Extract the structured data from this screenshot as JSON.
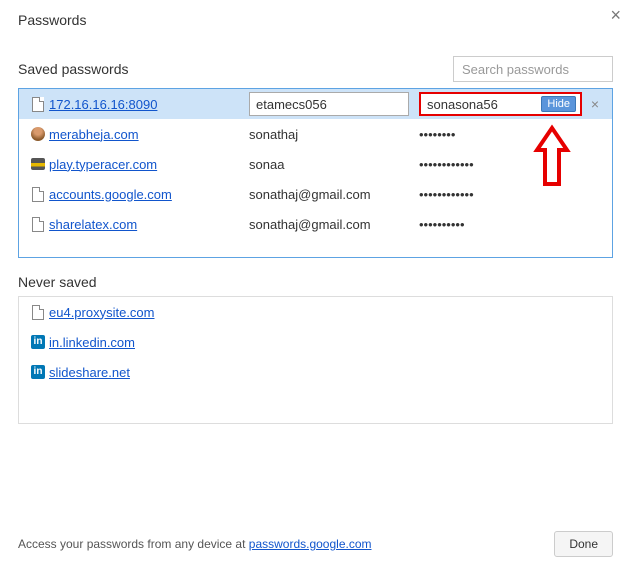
{
  "dialog": {
    "title": "Passwords",
    "close_glyph": "×"
  },
  "search": {
    "placeholder": "Search passwords"
  },
  "saved": {
    "title": "Saved passwords",
    "rows": [
      {
        "icon": "doc",
        "site": "172.16.16.16:8090",
        "username": "etamecs056",
        "password_plain": "sonasona56",
        "hide_label": "Hide",
        "delete_glyph": "×",
        "selected": true
      },
      {
        "icon": "avatar",
        "site": "merabheja.com",
        "username": "sonathaj",
        "password_mask": "••••••••"
      },
      {
        "icon": "typeracer",
        "site": "play.typeracer.com",
        "username": "sonaa",
        "password_mask": "••••••••••••"
      },
      {
        "icon": "doc",
        "site": "accounts.google.com",
        "username": "sonathaj@gmail.com",
        "password_mask": "••••••••••••"
      },
      {
        "icon": "doc",
        "site": "sharelatex.com",
        "username": "sonathaj@gmail.com",
        "password_mask": "••••••••••"
      }
    ]
  },
  "never": {
    "title": "Never saved",
    "rows": [
      {
        "icon": "doc",
        "site": "eu4.proxysite.com"
      },
      {
        "icon": "linkedin",
        "site": "in.linkedin.com"
      },
      {
        "icon": "linkedin",
        "site": "slideshare.net"
      }
    ]
  },
  "footer": {
    "text_before": "Access your passwords from any device at ",
    "link_text": "passwords.google.com",
    "done_label": "Done"
  },
  "icons": {
    "linkedin_glyph": "in"
  }
}
